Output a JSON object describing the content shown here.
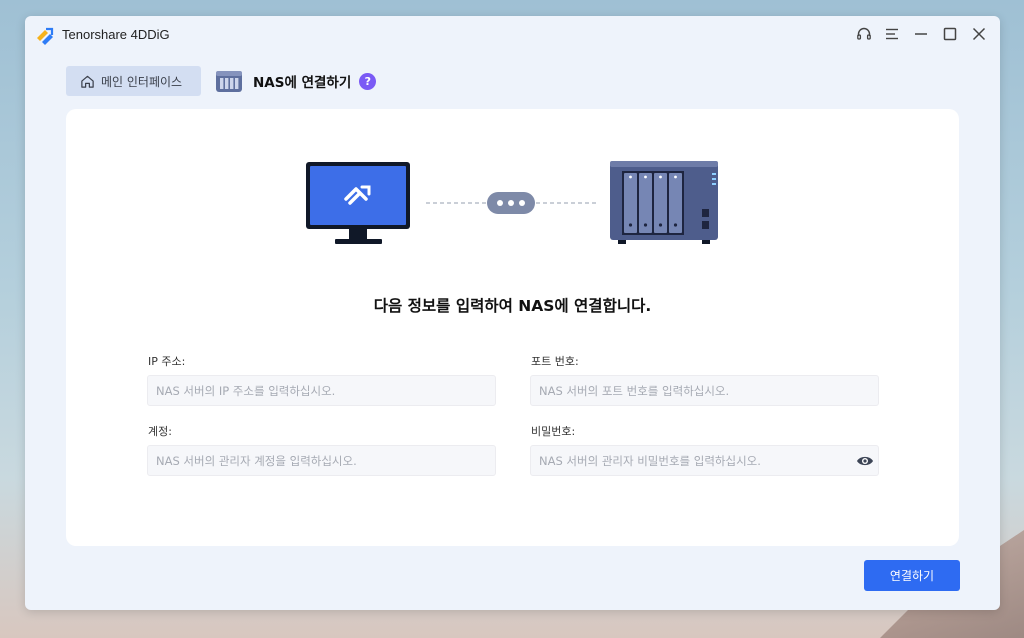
{
  "app": {
    "title": "Tenorshare 4DDiG"
  },
  "window_controls": [
    "headset-icon",
    "menu-icon",
    "minimize-icon",
    "maximize-icon",
    "close-icon"
  ],
  "nav": {
    "home_label": "메인 인터페이스",
    "current_label": "NAS에 연결하기",
    "help_symbol": "?"
  },
  "main": {
    "headline": "다음 정보를 입력하여 NAS에 연결합니다.",
    "fields": {
      "ip": {
        "label": "IP 주소:",
        "value": "",
        "placeholder": "NAS 서버의 IP 주소를 입력하십시오."
      },
      "port": {
        "label": "포트 번호:",
        "value": "",
        "placeholder": "NAS 서버의 포트 번호를 입력하십시오."
      },
      "account": {
        "label": "계정:",
        "value": "",
        "placeholder": "NAS 서버의 관리자 계정을 입력하십시오."
      },
      "password": {
        "label": "비밀번호:",
        "value": "",
        "placeholder": "NAS 서버의 관리자 비밀번호를 입력하십시오."
      }
    },
    "connect_label": "연결하기"
  },
  "colors": {
    "accent": "#2e6bf2",
    "monitor_screen": "#3d6ee8",
    "nas_device": "#4e5d8c",
    "help_badge": "#7a5af5"
  }
}
